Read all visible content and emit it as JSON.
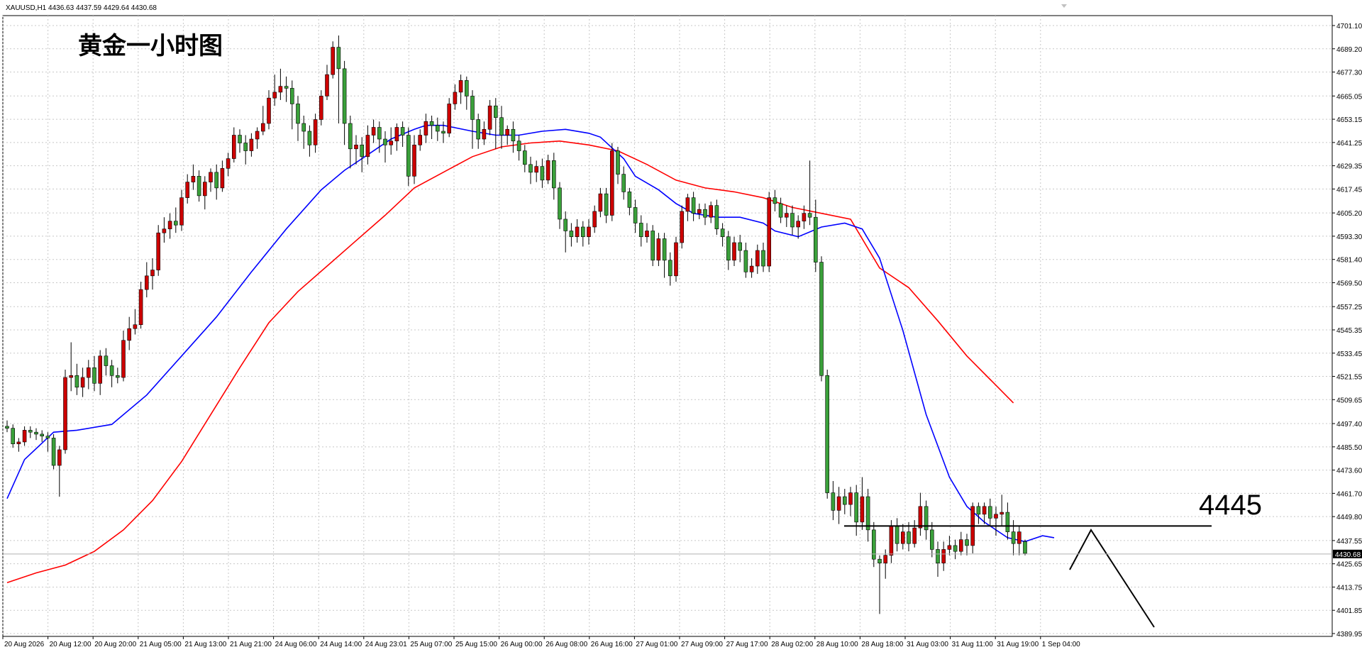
{
  "window": {
    "header_text": "XAUUSD,H1  4436.63 4437.59 4429.64 4430.68"
  },
  "chart_data": {
    "type": "candlestick",
    "symbol": "XAUUSD",
    "timeframe": "H1",
    "title": "黄金一小时图",
    "current_price": 4430.68,
    "ylim": [
      4389.95,
      4701.1
    ],
    "y_ticks": [
      "4701.10",
      "4689.20",
      "4677.30",
      "4665.05",
      "4653.15",
      "4641.25",
      "4629.35",
      "4617.45",
      "4605.20",
      "4593.30",
      "4581.40",
      "4569.50",
      "4557.25",
      "4545.35",
      "4533.45",
      "4521.55",
      "4509.65",
      "4497.40",
      "4485.50",
      "4473.60",
      "4461.70",
      "4449.80",
      "4437.55",
      "4425.65",
      "4413.75",
      "4401.85",
      "4389.95"
    ],
    "x_ticks": [
      "20 Aug 2026",
      "20 Aug 12:00",
      "20 Aug 20:00",
      "21 Aug 05:00",
      "21 Aug 13:00",
      "21 Aug 21:00",
      "24 Aug 06:00",
      "24 Aug 14:00",
      "24 Aug 23:01",
      "25 Aug 07:00",
      "25 Aug 15:00",
      "26 Aug 00:00",
      "26 Aug 08:00",
      "26 Aug 16:00",
      "27 Aug 01:00",
      "27 Aug 09:00",
      "27 Aug 17:00",
      "28 Aug 02:00",
      "28 Aug 10:00",
      "28 Aug 18:00",
      "31 Aug 03:00",
      "31 Aug 11:00",
      "31 Aug 19:00",
      "1 Sep 04:00"
    ],
    "annotation": {
      "level_label": "4445",
      "level_value": 4445
    },
    "colors": {
      "bull": "#cc0000",
      "bear": "#3aa03a",
      "wick": "#000000",
      "ma_fast": "#0000ff",
      "ma_slow": "#ff0000",
      "grid": "#c8c8c8"
    },
    "ma_fast": [
      [
        0,
        4459
      ],
      [
        3,
        4479
      ],
      [
        8,
        4493
      ],
      [
        12,
        4494
      ],
      [
        18,
        4497
      ],
      [
        24,
        4512
      ],
      [
        30,
        4532
      ],
      [
        36,
        4552
      ],
      [
        42,
        4575
      ],
      [
        48,
        4597
      ],
      [
        54,
        4617
      ],
      [
        58,
        4627
      ],
      [
        63,
        4637
      ],
      [
        66,
        4643
      ],
      [
        70,
        4648
      ],
      [
        72,
        4650
      ],
      [
        75,
        4650
      ],
      [
        80,
        4647
      ],
      [
        84,
        4645
      ],
      [
        88,
        4645
      ],
      [
        92,
        4647
      ],
      [
        96,
        4648
      ],
      [
        100,
        4646
      ],
      [
        102,
        4644
      ],
      [
        106,
        4633
      ],
      [
        108,
        4624
      ],
      [
        112,
        4617
      ],
      [
        115,
        4610
      ],
      [
        118,
        4605
      ],
      [
        122,
        4603
      ],
      [
        126,
        4603
      ],
      [
        130,
        4600
      ],
      [
        132,
        4596
      ],
      [
        136,
        4593
      ],
      [
        140,
        4598
      ],
      [
        144,
        4600
      ],
      [
        147,
        4597
      ],
      [
        150,
        4582
      ],
      [
        154,
        4545
      ],
      [
        158,
        4502
      ],
      [
        162,
        4470
      ],
      [
        165,
        4455
      ],
      [
        168,
        4447
      ],
      [
        172,
        4439
      ],
      [
        175,
        4437
      ],
      [
        178,
        4440
      ],
      [
        180,
        4439
      ]
    ],
    "ma_slow": [
      [
        0,
        4416
      ],
      [
        5,
        4421
      ],
      [
        10,
        4425
      ],
      [
        15,
        4432
      ],
      [
        20,
        4443
      ],
      [
        25,
        4458
      ],
      [
        30,
        4478
      ],
      [
        35,
        4502
      ],
      [
        40,
        4526
      ],
      [
        45,
        4549
      ],
      [
        50,
        4565
      ],
      [
        55,
        4578
      ],
      [
        60,
        4591
      ],
      [
        65,
        4604
      ],
      [
        70,
        4618
      ],
      [
        75,
        4626
      ],
      [
        80,
        4634
      ],
      [
        85,
        4639
      ],
      [
        90,
        4641
      ],
      [
        95,
        4642
      ],
      [
        100,
        4640
      ],
      [
        105,
        4637
      ],
      [
        110,
        4630
      ],
      [
        115,
        4622
      ],
      [
        120,
        4618
      ],
      [
        125,
        4616
      ],
      [
        130,
        4613
      ],
      [
        135,
        4608
      ],
      [
        140,
        4605
      ],
      [
        145,
        4602
      ],
      [
        150,
        4577
      ],
      [
        155,
        4567
      ],
      [
        160,
        4550
      ],
      [
        165,
        4532
      ],
      [
        170,
        4517
      ],
      [
        173,
        4508
      ]
    ],
    "candles": [
      [
        4496,
        4495,
        4499,
        4493
      ],
      [
        4495,
        4487,
        4497,
        4485
      ],
      [
        4487,
        4488,
        4490,
        4483
      ],
      [
        4488,
        4494,
        4496,
        4486
      ],
      [
        4494,
        4493,
        4496,
        4490
      ],
      [
        4493,
        4492,
        4495,
        4489
      ],
      [
        4492,
        4491,
        4494,
        4488
      ],
      [
        4491,
        4490,
        4493,
        4483
      ],
      [
        4490,
        4476,
        4492,
        4474
      ],
      [
        4476,
        4484,
        4486,
        4460
      ],
      [
        4484,
        4521,
        4525,
        4482
      ],
      [
        4521,
        4522,
        4539,
        4514
      ],
      [
        4522,
        4516,
        4528,
        4512
      ],
      [
        4516,
        4521,
        4526,
        4511
      ],
      [
        4521,
        4526,
        4530,
        4515
      ],
      [
        4526,
        4518,
        4532,
        4514
      ],
      [
        4518,
        4532,
        4535,
        4512
      ],
      [
        4532,
        4527,
        4536,
        4522
      ],
      [
        4527,
        4522,
        4530,
        4516
      ],
      [
        4522,
        4521,
        4526,
        4518
      ],
      [
        4521,
        4540,
        4545,
        4519
      ],
      [
        4540,
        4546,
        4552,
        4535
      ],
      [
        4546,
        4548,
        4556,
        4543
      ],
      [
        4548,
        4566,
        4570,
        4546
      ],
      [
        4566,
        4573,
        4580,
        4562
      ],
      [
        4573,
        4576,
        4582,
        4566
      ],
      [
        4576,
        4595,
        4599,
        4573
      ],
      [
        4595,
        4597,
        4603,
        4590
      ],
      [
        4597,
        4601,
        4605,
        4592
      ],
      [
        4601,
        4599,
        4608,
        4595
      ],
      [
        4599,
        4613,
        4617,
        4596
      ],
      [
        4613,
        4621,
        4625,
        4610
      ],
      [
        4621,
        4624,
        4630,
        4617
      ],
      [
        4624,
        4614,
        4627,
        4611
      ],
      [
        4614,
        4621,
        4624,
        4607
      ],
      [
        4621,
        4626,
        4628,
        4616
      ],
      [
        4626,
        4618,
        4630,
        4612
      ],
      [
        4618,
        4628,
        4632,
        4616
      ],
      [
        4628,
        4633,
        4636,
        4624
      ],
      [
        4633,
        4645,
        4649,
        4631
      ],
      [
        4645,
        4641,
        4648,
        4636
      ],
      [
        4641,
        4637,
        4645,
        4630
      ],
      [
        4637,
        4643,
        4646,
        4634
      ],
      [
        4643,
        4647,
        4649,
        4638
      ],
      [
        4647,
        4651,
        4660,
        4645
      ],
      [
        4651,
        4664,
        4668,
        4648
      ],
      [
        4664,
        4667,
        4676,
        4660
      ],
      [
        4667,
        4670,
        4679,
        4663
      ],
      [
        4670,
        4669,
        4675,
        4662
      ],
      [
        4669,
        4661,
        4673,
        4648
      ],
      [
        4661,
        4651,
        4665,
        4642
      ],
      [
        4651,
        4647,
        4655,
        4638
      ],
      [
        4647,
        4640,
        4650,
        4634
      ],
      [
        4640,
        4653,
        4656,
        4636
      ],
      [
        4653,
        4665,
        4668,
        4650
      ],
      [
        4665,
        4676,
        4681,
        4663
      ],
      [
        4676,
        4690,
        4693,
        4674
      ],
      [
        4690,
        4679,
        4696,
        4651
      ],
      [
        4679,
        4651,
        4683,
        4640
      ],
      [
        4651,
        4638,
        4655,
        4628
      ],
      [
        4638,
        4640,
        4645,
        4630
      ],
      [
        4640,
        4634,
        4644,
        4626
      ],
      [
        4634,
        4645,
        4650,
        4630
      ],
      [
        4645,
        4649,
        4653,
        4641
      ],
      [
        4649,
        4643,
        4652,
        4636
      ],
      [
        4643,
        4640,
        4647,
        4631
      ],
      [
        4640,
        4642,
        4649,
        4635
      ],
      [
        4642,
        4649,
        4651,
        4637
      ],
      [
        4649,
        4645,
        4652,
        4639
      ],
      [
        4645,
        4624,
        4649,
        4619
      ],
      [
        4624,
        4640,
        4645,
        4620
      ],
      [
        4640,
        4645,
        4648,
        4637
      ],
      [
        4645,
        4652,
        4656,
        4641
      ],
      [
        4652,
        4650,
        4655,
        4643
      ],
      [
        4650,
        4647,
        4654,
        4642
      ],
      [
        4647,
        4646,
        4652,
        4641
      ],
      [
        4646,
        4661,
        4664,
        4644
      ],
      [
        4661,
        4667,
        4671,
        4658
      ],
      [
        4667,
        4673,
        4676,
        4661
      ],
      [
        4673,
        4665,
        4675,
        4658
      ],
      [
        4665,
        4653,
        4668,
        4638
      ],
      [
        4653,
        4643,
        4656,
        4638
      ],
      [
        4643,
        4648,
        4652,
        4640
      ],
      [
        4648,
        4660,
        4663,
        4645
      ],
      [
        4660,
        4654,
        4664,
        4638
      ],
      [
        4654,
        4645,
        4660,
        4638
      ],
      [
        4645,
        4648,
        4650,
        4640
      ],
      [
        4648,
        4642,
        4652,
        4636
      ],
      [
        4642,
        4637,
        4645,
        4632
      ],
      [
        4637,
        4630,
        4640,
        4626
      ],
      [
        4630,
        4626,
        4634,
        4620
      ],
      [
        4626,
        4629,
        4632,
        4621
      ],
      [
        4629,
        4622,
        4633,
        4618
      ],
      [
        4622,
        4632,
        4635,
        4620
      ],
      [
        4632,
        4618,
        4636,
        4612
      ],
      [
        4618,
        4602,
        4621,
        4597
      ],
      [
        4602,
        4596,
        4606,
        4585
      ],
      [
        4596,
        4593,
        4600,
        4588
      ],
      [
        4593,
        4598,
        4602,
        4590
      ],
      [
        4598,
        4593,
        4601,
        4588
      ],
      [
        4593,
        4598,
        4602,
        4589
      ],
      [
        4598,
        4606,
        4609,
        4595
      ],
      [
        4606,
        4615,
        4618,
        4603
      ],
      [
        4615,
        4604,
        4618,
        4600
      ],
      [
        4604,
        4637,
        4641,
        4601
      ],
      [
        4637,
        4625,
        4639,
        4620
      ],
      [
        4625,
        4616,
        4629,
        4612
      ],
      [
        4616,
        4608,
        4618,
        4604
      ],
      [
        4608,
        4600,
        4612,
        4595
      ],
      [
        4600,
        4593,
        4604,
        4588
      ],
      [
        4593,
        4596,
        4600,
        4590
      ],
      [
        4596,
        4581,
        4599,
        4578
      ],
      [
        4581,
        4592,
        4595,
        4578
      ],
      [
        4592,
        4581,
        4595,
        4572
      ],
      [
        4581,
        4573,
        4585,
        4568
      ],
      [
        4573,
        4590,
        4593,
        4570
      ],
      [
        4590,
        4606,
        4609,
        4587
      ],
      [
        4606,
        4613,
        4615,
        4601
      ],
      [
        4613,
        4605,
        4616,
        4601
      ],
      [
        4605,
        4607,
        4610,
        4602
      ],
      [
        4607,
        4603,
        4610,
        4599
      ],
      [
        4603,
        4609,
        4611,
        4600
      ],
      [
        4609,
        4597,
        4612,
        4594
      ],
      [
        4597,
        4593,
        4600,
        4588
      ],
      [
        4593,
        4581,
        4596,
        4576
      ],
      [
        4581,
        4590,
        4593,
        4578
      ],
      [
        4590,
        4586,
        4594,
        4580
      ],
      [
        4586,
        4575,
        4590,
        4572
      ],
      [
        4575,
        4578,
        4582,
        4572
      ],
      [
        4578,
        4586,
        4589,
        4574
      ],
      [
        4586,
        4578,
        4590,
        4575
      ],
      [
        4578,
        4613,
        4616,
        4575
      ],
      [
        4613,
        4610,
        4617,
        4606
      ],
      [
        4610,
        4603,
        4613,
        4600
      ],
      [
        4603,
        4605,
        4609,
        4598
      ],
      [
        4605,
        4598,
        4609,
        4594
      ],
      [
        4598,
        4601,
        4604,
        4592
      ],
      [
        4601,
        4605,
        4609,
        4597
      ],
      [
        4605,
        4603,
        4632,
        4599
      ],
      [
        4603,
        4580,
        4612,
        4575
      ],
      [
        4580,
        4522,
        4583,
        4519
      ],
      [
        4522,
        4462,
        4525,
        4459
      ],
      [
        4462,
        4453,
        4468,
        4448
      ],
      [
        4453,
        4460,
        4465,
        4446
      ],
      [
        4460,
        4456,
        4464,
        4451
      ],
      [
        4456,
        4462,
        4465,
        4450
      ],
      [
        4462,
        4447,
        4466,
        4440
      ],
      [
        4447,
        4460,
        4470,
        4443
      ],
      [
        4460,
        4443,
        4464,
        4437
      ],
      [
        4443,
        4428,
        4447,
        4424
      ],
      [
        4428,
        4426,
        4430,
        4400
      ],
      [
        4426,
        4430,
        4433,
        4418
      ],
      [
        4430,
        4445,
        4448,
        4426
      ],
      [
        4445,
        4436,
        4449,
        4432
      ],
      [
        4436,
        4442,
        4446,
        4433
      ],
      [
        4442,
        4436,
        4447,
        4432
      ],
      [
        4436,
        4444,
        4448,
        4434
      ],
      [
        4444,
        4455,
        4462,
        4440
      ],
      [
        4455,
        4443,
        4458,
        4438
      ],
      [
        4443,
        4433,
        4447,
        4429
      ],
      [
        4433,
        4426,
        4437,
        4419
      ],
      [
        4426,
        4433,
        4437,
        4422
      ],
      [
        4433,
        4435,
        4440,
        4430
      ],
      [
        4435,
        4432,
        4438,
        4428
      ],
      [
        4432,
        4438,
        4442,
        4430
      ],
      [
        4438,
        4435,
        4441,
        4430
      ],
      [
        4435,
        4455,
        4457,
        4431
      ],
      [
        4455,
        4451,
        4457,
        4446
      ],
      [
        4451,
        4455,
        4457,
        4446
      ],
      [
        4455,
        4449,
        4459,
        4445
      ],
      [
        4449,
        4451,
        4455,
        4440
      ],
      [
        4451,
        4452,
        4461,
        4445
      ],
      [
        4452,
        4442,
        4457,
        4438
      ],
      [
        4442,
        4436,
        4448,
        4430
      ],
      [
        4436,
        4442,
        4445,
        4430
      ],
      [
        4437,
        4431,
        4438,
        4430
      ]
    ]
  }
}
